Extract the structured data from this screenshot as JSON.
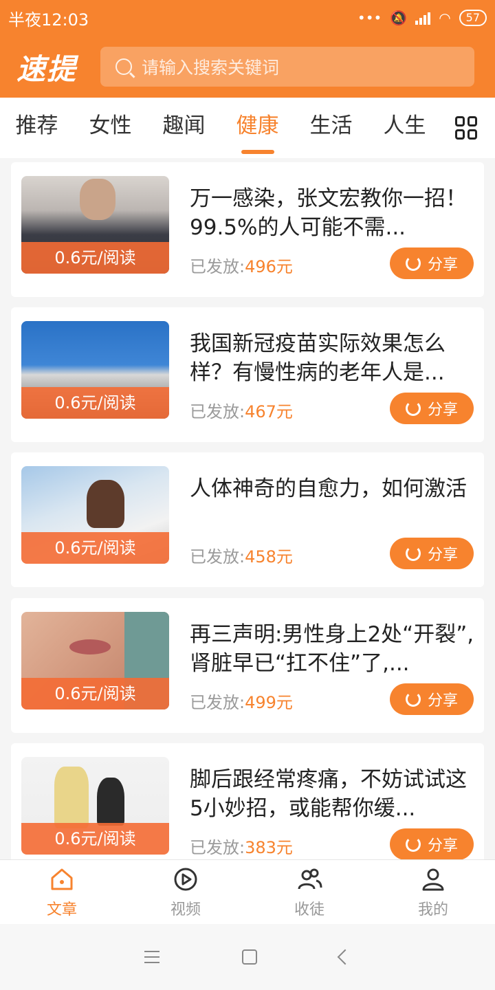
{
  "status_bar": {
    "time": "半夜12:03",
    "battery": "57",
    "dots": "•••"
  },
  "header": {
    "logo": "速提",
    "search_placeholder": "请输入搜索关键词"
  },
  "tabs": [
    {
      "label": "推荐"
    },
    {
      "label": "女性"
    },
    {
      "label": "趣闻"
    },
    {
      "label": "健康",
      "active": true
    },
    {
      "label": "生活"
    },
    {
      "label": "人生"
    }
  ],
  "articles": [
    {
      "title": "万一感染，张文宏教你一招！99.5%的人可能不需...",
      "rate": "0.6元/阅读",
      "paid_label": "已发放:",
      "paid_amount": "496元",
      "share": "分享"
    },
    {
      "title": "我国新冠疫苗实际效果怎么样？有慢性病的老年人是...",
      "rate": "0.6元/阅读",
      "paid_label": "已发放:",
      "paid_amount": "467元",
      "share": "分享"
    },
    {
      "title": "人体神奇的自愈力，如何激活",
      "rate": "0.6元/阅读",
      "paid_label": "已发放:",
      "paid_amount": "458元",
      "share": "分享"
    },
    {
      "title": "再三声明:男性身上2处“开裂”,肾脏早已“扛不住”了,...",
      "rate": "0.6元/阅读",
      "paid_label": "已发放:",
      "paid_amount": "499元",
      "share": "分享"
    },
    {
      "title": "脚后跟经常疼痛，不妨试试这5小妙招，或能帮你缓...",
      "rate": "0.6元/阅读",
      "paid_label": "已发放:",
      "paid_amount": "383元",
      "share": "分享"
    }
  ],
  "bottom_nav": [
    {
      "label": "文章",
      "icon": "home-icon",
      "active": true
    },
    {
      "label": "视频",
      "icon": "play-icon"
    },
    {
      "label": "收徒",
      "icon": "users-icon"
    },
    {
      "label": "我的",
      "icon": "user-icon"
    }
  ],
  "colors": {
    "accent": "#f7832e",
    "text": "#222222",
    "muted": "#9a9a9a"
  }
}
